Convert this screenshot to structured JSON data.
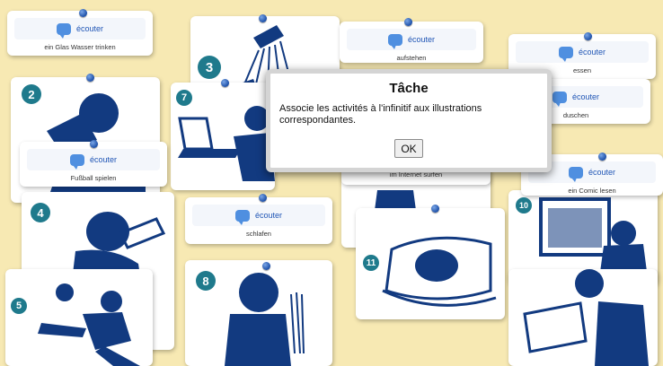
{
  "listen_label": "écouter",
  "labels": [
    {
      "id": "glas",
      "text": "ein Glas Wasser trinken"
    },
    {
      "id": "aufstehen",
      "text": "aufstehen"
    },
    {
      "id": "essen",
      "text": "essen"
    },
    {
      "id": "duschen",
      "text": "duschen"
    },
    {
      "id": "fussball",
      "text": "Fußball spielen"
    },
    {
      "id": "internet",
      "text": "im Internet surfen"
    },
    {
      "id": "comics",
      "text": "ein Comic lesen"
    },
    {
      "id": "schlafen",
      "text": "schlafen"
    }
  ],
  "badges": {
    "b2": "2",
    "b3": "3",
    "b4": "4",
    "b5": "5",
    "b7": "7",
    "b8": "8",
    "b10": "10",
    "b11": "11"
  },
  "dialog": {
    "title": "Tâche",
    "message": "Associe les activités à l'infinitif aux illustrations correspondantes.",
    "ok_label": "OK"
  },
  "colors": {
    "background": "#f7e9b3",
    "silhouette": "#123a80",
    "badge": "#1f7a8c",
    "listen_text": "#1f55b5"
  },
  "icons": [
    "speech-bubble-icon",
    "pushpin-icon"
  ]
}
